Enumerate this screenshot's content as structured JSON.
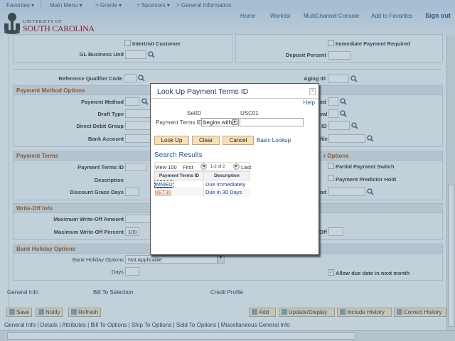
{
  "nav": {
    "favorites": "Favorites ▾",
    "main_menu": "Main Menu ▾",
    "grants": "> Grants ▾",
    "sponsors": "> Sponsors ▾",
    "general_information": "> General Information"
  },
  "header": {
    "logo_line1": "UNIVERSITY OF",
    "logo_line2": "SOUTH CAROLINA",
    "links": [
      "Home",
      "Worklist",
      "MultiChannel Console",
      "Add to Favorites",
      "Sign out"
    ]
  },
  "form": {
    "interunit_customer": "InterUnit Customer",
    "gl_business_unit": "GL Business Unit",
    "immediate_payment_required": "Immediate Payment Required",
    "deposit_percent": "Deposit Percent",
    "reference_qualifier_code": "Reference Qualifier Code",
    "aging_id": "Aging ID",
    "payment_method_options": {
      "title": "Payment Method Options",
      "payment_method": "Payment Method",
      "draft_type": "Draft Type",
      "direct_debit_group": "Direct Debit Group",
      "bank_account": "Bank Account",
      "right_fragments": [
        "ed",
        "val",
        "ID",
        "file"
      ]
    },
    "payment_terms": {
      "title": "Payment Terms",
      "right_title_fragment": "r Options",
      "payment_terms_id": "Payment Terms ID",
      "description": "Description",
      "discount_grace_days": "Discount Grace Days",
      "partial_payment_switch": "Partial Payment Switch",
      "payment_predictor_hold": "Payment Predictor Hold",
      "right_fragment": "od"
    },
    "write_off": {
      "title": "Write-Off Info",
      "max_amount": "Maximum Write-Off Amount",
      "max_percent": "Maximum Write-Off Percent",
      "max_percent_value": "100",
      "right_fragment": "Off"
    },
    "bank_holiday": {
      "title": "Bank Holiday Options",
      "options_label": "Bank Holiday Options",
      "options_value": "Not Applicable",
      "days": "Days",
      "allow_next_month": "Allow due date in next month",
      "allow_next_month_checked": true
    }
  },
  "page_links": [
    "General Info",
    "Bill To Selection",
    "Credit Profile"
  ],
  "buttons": {
    "save": "Save",
    "notify": "Notify",
    "refresh": "Refresh",
    "add": "Add",
    "update_display": "Update/Display",
    "include_history": "Include History",
    "correct_history": "Correct History"
  },
  "footer_links": [
    "General Info",
    "Details",
    "Attributes",
    "Bill To Options",
    "Ship To Options",
    "Sold To Options",
    "Miscellaneous General Info"
  ],
  "modal": {
    "title": "Look Up Payment Terms ID",
    "help": "Help",
    "setid_label": "SetID",
    "setid_value": "USC01",
    "terms_label": "Payment Terms ID",
    "operator": "begins with",
    "search_value": "",
    "look_up": "Look Up",
    "clear": "Clear",
    "cancel": "Cancel",
    "basic_lookup": "Basic Lookup",
    "results_title": "Search Results",
    "view": "View 100",
    "first": "First",
    "range": "1-2 of 2",
    "last": "Last",
    "columns": [
      "Payment Terms ID",
      "Description"
    ],
    "rows": [
      [
        "IMMED",
        "Due Immediately"
      ],
      [
        "NET30",
        "Due in 30 Days"
      ]
    ]
  }
}
